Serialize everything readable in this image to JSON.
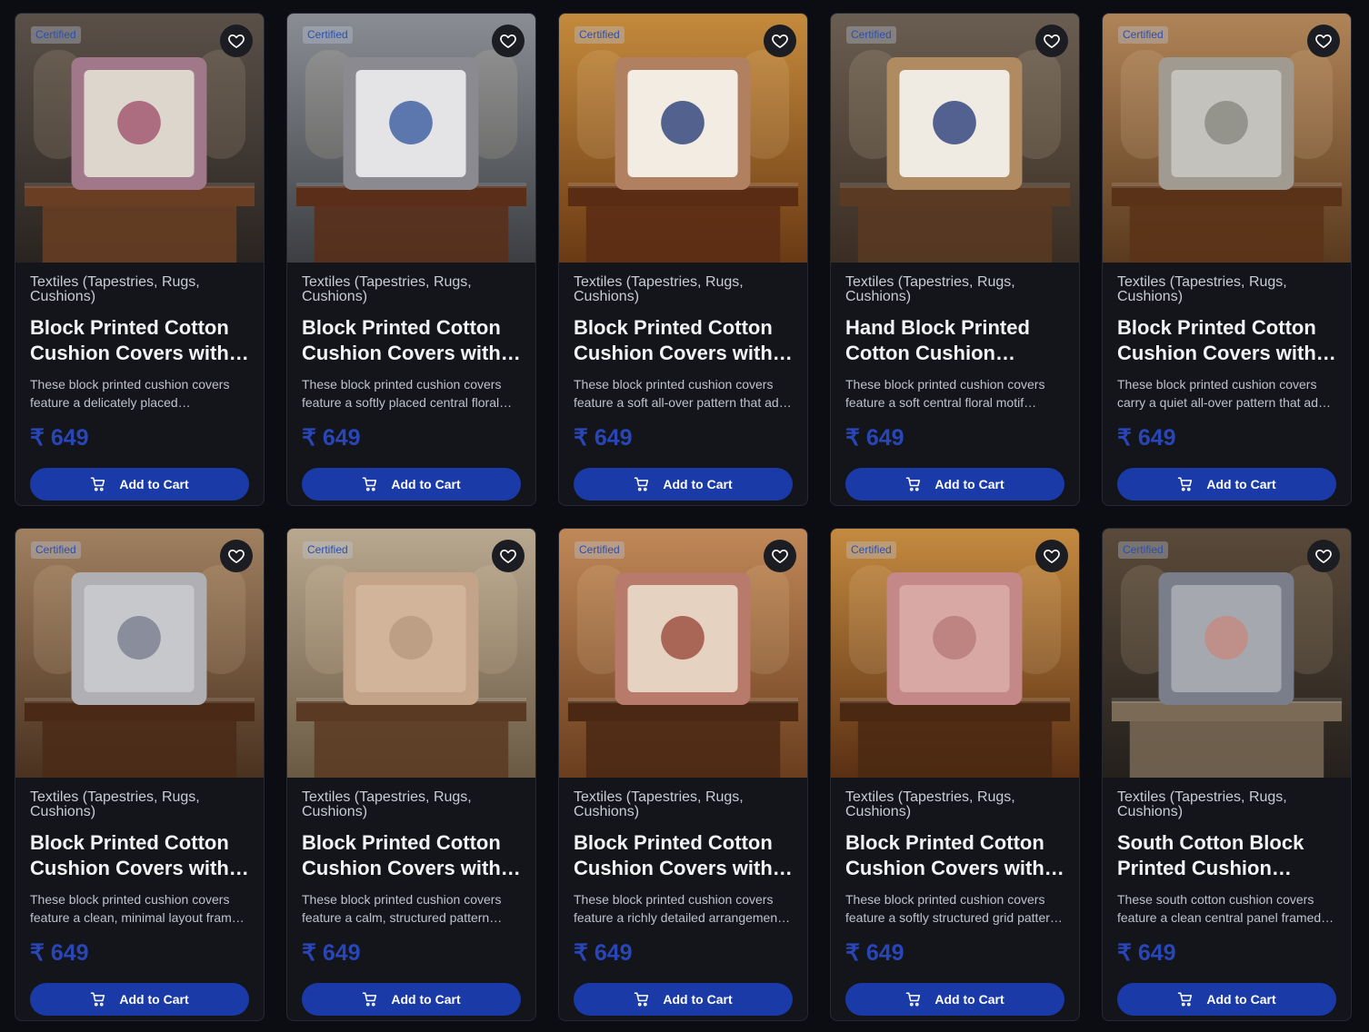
{
  "colors": {
    "background": "#0b0d12",
    "card": "#13151b",
    "accent": "#1a3aa8",
    "price": "#2946b8"
  },
  "icons": {
    "favorite": "heart-icon",
    "cart": "cart-icon"
  },
  "products": [
    {
      "badge": "Certified",
      "category": "Textiles (Tapestries, Rugs, Cushions)",
      "title": "Block Printed Cotton Cushion Covers with Instrument Motif",
      "description": "These block printed cushion covers feature a delicately placed instrumental motif",
      "price": "₹ 649",
      "button": "Add to Cart"
    },
    {
      "badge": "Certified",
      "category": "Textiles (Tapestries, Rugs, Cushions)",
      "title": "Block Printed Cotton Cushion Covers with Floral Motif",
      "description": "These block printed cushion covers feature a softly placed central floral motif",
      "price": "₹ 649",
      "button": "Add to Cart"
    },
    {
      "badge": "Certified",
      "category": "Textiles (Tapestries, Rugs, Cushions)",
      "title": "Block Printed Cotton Cushion Covers with Elephant Motif",
      "description": "These block printed cushion covers feature a soft all-over pattern that adds charm",
      "price": "₹ 649",
      "button": "Add to Cart"
    },
    {
      "badge": "Certified",
      "category": "Textiles (Tapestries, Rugs, Cushions)",
      "title": "Hand Block Printed Cotton Cushion Covers",
      "description": "These block printed cushion covers feature a soft central floral motif framed",
      "price": "₹ 649",
      "button": "Add to Cart"
    },
    {
      "badge": "Certified",
      "category": "Textiles (Tapestries, Rugs, Cushions)",
      "title": "Block Printed Cotton Cushion Covers with Pattern",
      "description": "These block printed cushion covers carry a quiet all-over pattern that adds depth",
      "price": "₹ 649",
      "button": "Add to Cart"
    },
    {
      "badge": "Certified",
      "category": "Textiles (Tapestries, Rugs, Cushions)",
      "title": "Block Printed Cotton Cushion Covers with Border",
      "description": "These block printed cushion covers feature a clean, minimal layout framed by borders",
      "price": "₹ 649",
      "button": "Add to Cart"
    },
    {
      "badge": "Certified",
      "category": "Textiles (Tapestries, Rugs, Cushions)",
      "title": "Block Printed Cotton Cushion Covers with Stripes",
      "description": "These block printed cushion covers feature a calm, structured pattern throughout",
      "price": "₹ 649",
      "button": "Add to Cart"
    },
    {
      "badge": "Certified",
      "category": "Textiles (Tapestries, Rugs, Cushions)",
      "title": "Block Printed Cotton Cushion Covers with Paisley",
      "description": "These block printed cushion covers feature a richly detailed arrangement of motifs",
      "price": "₹ 649",
      "button": "Add to Cart"
    },
    {
      "badge": "Certified",
      "category": "Textiles (Tapestries, Rugs, Cushions)",
      "title": "Block Printed Cotton Cushion Covers with Grid",
      "description": "These block printed cushion covers feature a softly structured grid pattern overall",
      "price": "₹ 649",
      "button": "Add to Cart"
    },
    {
      "badge": "Certified",
      "category": "Textiles (Tapestries, Rugs, Cushions)",
      "title": "South Cotton Block Printed Cushion Covers",
      "description": "These south cotton cushion covers feature a clean central panel framed by borders",
      "price": "₹ 649",
      "button": "Add to Cart"
    }
  ]
}
